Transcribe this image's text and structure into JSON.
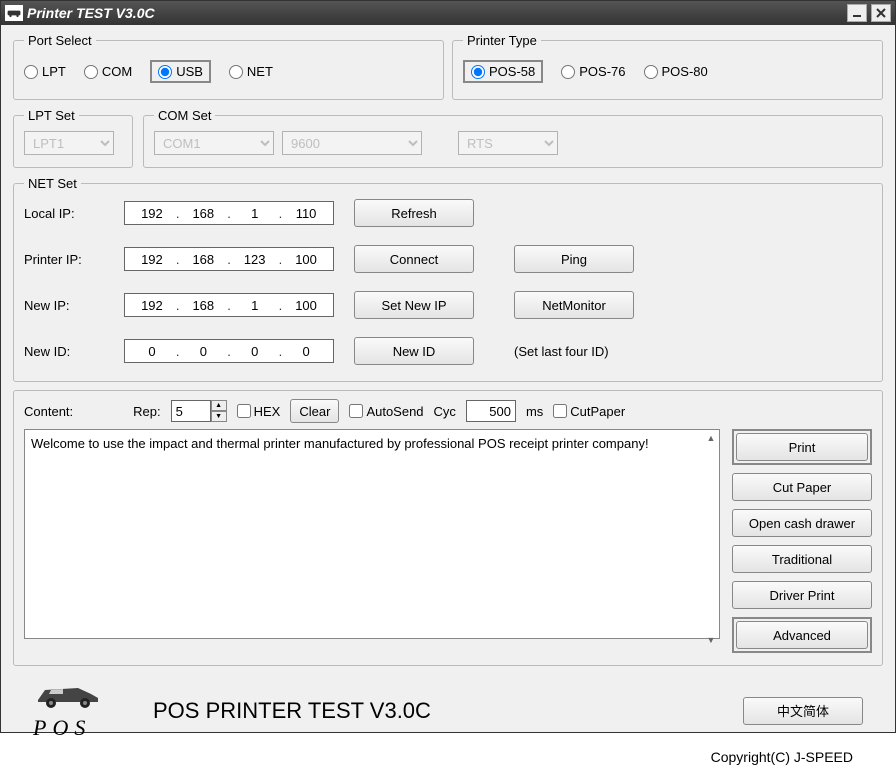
{
  "title": "Printer TEST V3.0C",
  "portSelect": {
    "legend": "Port Select",
    "options": [
      "LPT",
      "COM",
      "USB",
      "NET"
    ],
    "selected": "USB"
  },
  "printerType": {
    "legend": "Printer Type",
    "options": [
      "POS-58",
      "POS-76",
      "POS-80"
    ],
    "selected": "POS-58"
  },
  "lptSet": {
    "legend": "LPT Set",
    "value": "LPT1"
  },
  "comSet": {
    "legend": "COM Set",
    "port": "COM1",
    "baud": "9600",
    "flow": "RTS"
  },
  "netSet": {
    "legend": "NET Set",
    "localIP": {
      "label": "Local IP:",
      "seg": [
        "192",
        "168",
        "1",
        "110"
      ]
    },
    "printerIP": {
      "label": "Printer IP:",
      "seg": [
        "192",
        "168",
        "123",
        "100"
      ]
    },
    "newIP": {
      "label": "New IP:",
      "seg": [
        "192",
        "168",
        "1",
        "100"
      ]
    },
    "newID": {
      "label": "New ID:",
      "seg": [
        "0",
        "0",
        "0",
        "0"
      ]
    },
    "buttons": {
      "refresh": "Refresh",
      "connect": "Connect",
      "ping": "Ping",
      "setNewIP": "Set New IP",
      "netMonitor": "NetMonitor",
      "newID": "New ID"
    },
    "hint": "(Set last four ID)"
  },
  "contentArea": {
    "legend": "Content:",
    "repLabel": "Rep:",
    "repValue": "5",
    "hexLabel": "HEX",
    "clearLabel": "Clear",
    "autoSendLabel": "AutoSend",
    "cycLabel": "Cyc",
    "cycValue": "500",
    "cycUnit": "ms",
    "cutPaperChk": "CutPaper",
    "text": "Welcome to use the impact and thermal printer manufactured by professional POS receipt printer company!",
    "sideButtons": {
      "print": "Print",
      "cutPaper": "Cut Paper",
      "openDrawer": "Open cash drawer",
      "traditional": "Traditional",
      "driverPrint": "Driver Print",
      "advanced": "Advanced"
    }
  },
  "footer": {
    "posLabel": "POS",
    "title": "POS PRINTER TEST V3.0C",
    "langBtn": "中文简体",
    "copyright": "Copyright(C)  J-SPEED"
  }
}
